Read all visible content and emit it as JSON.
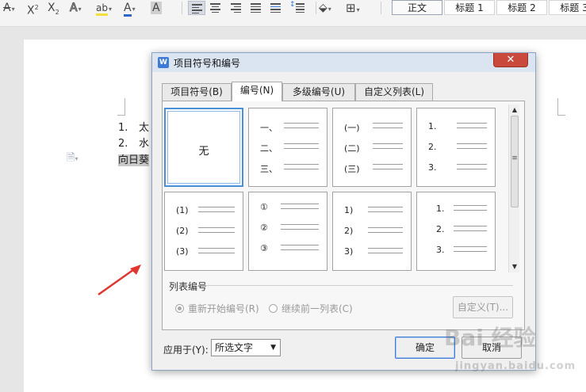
{
  "ribbon": {
    "font_effect_glyph": "A",
    "superscript_label": "X",
    "superscript_mark": "2",
    "subscript_label": "X",
    "subscript_mark": "2",
    "text_effect_glyph": "A",
    "highlight_glyph": "ab",
    "font_color_glyph": "A",
    "char_shading_glyph": "A",
    "styles": [
      "正文",
      "标题 1",
      "标题 2",
      "标题 3"
    ],
    "selected_style": "正文",
    "font_color": "#2f64c8",
    "highlight_color": "#f3e03c"
  },
  "document": {
    "list_lines": [
      {
        "num": "1.",
        "text": "太"
      },
      {
        "num": "2.",
        "text": "水"
      }
    ],
    "selected_line": "向日葵"
  },
  "dialog": {
    "title": "项目符号和编号",
    "close_label": "✕",
    "tabs": [
      "项目符号(B)",
      "编号(N)",
      "多级编号(U)",
      "自定义列表(L)"
    ],
    "active_tab": "编号(N)",
    "gallery": [
      {
        "none_label": "无"
      },
      {
        "markers": [
          "一、",
          "二、",
          "三、"
        ]
      },
      {
        "markers": [
          "(一)",
          "(二)",
          "(三)"
        ]
      },
      {
        "markers": [
          "1.",
          "2.",
          "3."
        ]
      },
      {
        "markers": [
          "(1)",
          "(2)",
          "(3)"
        ]
      },
      {
        "markers": [
          "①",
          "②",
          "③"
        ]
      },
      {
        "markers": [
          "1)",
          "2)",
          "3)"
        ]
      },
      {
        "markers": [
          "1.",
          "2.",
          "3."
        ]
      }
    ],
    "selected_index": 0,
    "scrollbar_thumb_glyph": "≡",
    "list_numbering_label": "列表编号",
    "restart_numbering_label": "重新开始编号(R)",
    "continue_list_label": "继续前一列表(C)",
    "restart_selected": true,
    "customize_label": "自定义(T)...",
    "apply_to_label": "应用于(Y):",
    "apply_to_value": "所选文字",
    "ok_label": "确定",
    "cancel_label": "取消"
  },
  "watermark": {
    "main": "Bai 经验",
    "sub": "jingyan.baidu.com"
  },
  "colors": {
    "accent": "#4a90d9",
    "close_button": "#c9493d",
    "arrow": "#e0362f"
  }
}
